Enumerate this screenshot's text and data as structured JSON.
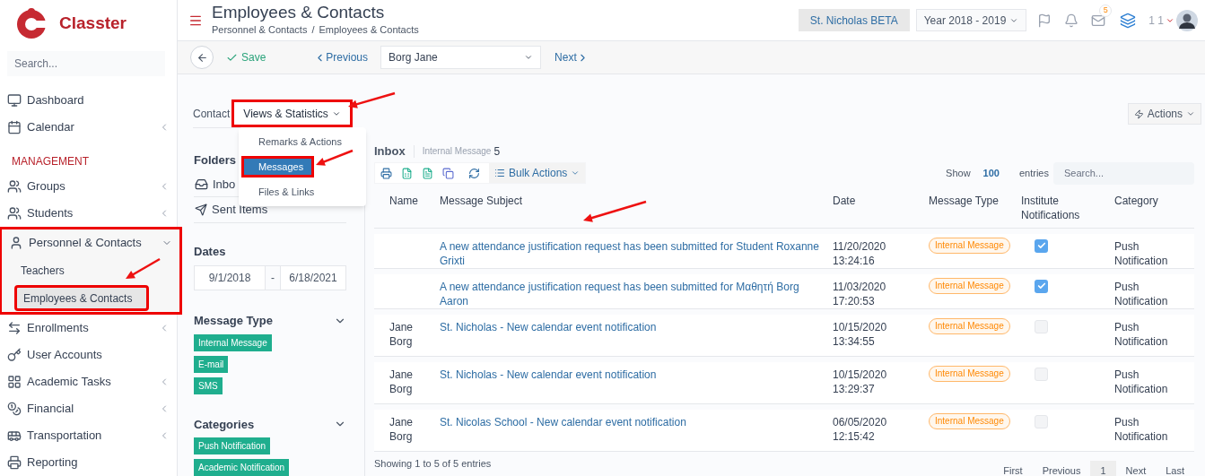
{
  "sidebar": {
    "logo_text": "Classter",
    "search_placeholder": "Search...",
    "items": [
      {
        "kind": "item",
        "label": "Dashboard",
        "highlighted": false
      },
      {
        "kind": "item",
        "label": "Calendar",
        "expanded": false,
        "highlighted": false
      },
      {
        "kind": "section",
        "label": "MANAGEMENT"
      },
      {
        "kind": "item",
        "label": "Groups",
        "expanded": false,
        "highlighted": false
      },
      {
        "kind": "item",
        "label": "Students",
        "expanded": false,
        "highlighted": false
      },
      {
        "kind": "item",
        "label": "Personnel & Contacts",
        "expanded": true,
        "highlighted": true,
        "children": [
          {
            "label": "Teachers",
            "selected": false,
            "highlighted": false
          },
          {
            "label": "Employees & Contacts",
            "selected": true,
            "highlighted": true
          }
        ]
      },
      {
        "kind": "item",
        "label": "Enrollments",
        "expanded": false,
        "highlighted": false
      },
      {
        "kind": "item",
        "label": "User Accounts",
        "highlighted": false
      },
      {
        "kind": "item",
        "label": "Academic Tasks",
        "expanded": false,
        "highlighted": false
      },
      {
        "kind": "item",
        "label": "Financial",
        "expanded": false,
        "highlighted": false
      },
      {
        "kind": "item",
        "label": "Transportation",
        "expanded": false,
        "highlighted": false
      },
      {
        "kind": "item",
        "label": "Reporting",
        "highlighted": false
      }
    ]
  },
  "header": {
    "title": "Employees & Contacts",
    "breadcrumb": [
      "Personnel & Contacts",
      "Employees & Contacts"
    ],
    "breadcrumb_separator": "/",
    "school": "St. Nicholas BETA",
    "year": "Year 2018 - 2019",
    "mail_badge": "5",
    "user": "1 1"
  },
  "toolbar": {
    "save": "Save",
    "previous": "Previous",
    "record": "Borg Jane",
    "next": "Next"
  },
  "tabs": [
    {
      "label": "Contact",
      "selected": false,
      "highlighted": false,
      "dropdown": false
    },
    {
      "label": "Views & Statistics",
      "selected": true,
      "highlighted": true,
      "dropdown": true
    }
  ],
  "tab_menu": [
    {
      "label": "Remarks & Actions",
      "selected": false,
      "highlighted": false
    },
    {
      "label": "Messages",
      "selected": true,
      "highlighted": true
    },
    {
      "label": "Files & Links",
      "selected": false,
      "highlighted": false
    }
  ],
  "actions": "Actions",
  "folders": {
    "title": "Folders",
    "items": [
      {
        "label": "Inbo",
        "kind": "inbox"
      },
      {
        "label": "Sent Items",
        "kind": "sent"
      }
    ]
  },
  "dates": {
    "title": "Dates",
    "from": "9/1/2018",
    "separator": "-",
    "to": "6/18/2021"
  },
  "filters": [
    {
      "title": "Message Type",
      "expanded": true,
      "tags": [
        "Internal Message",
        "E-mail",
        "SMS"
      ]
    },
    {
      "title": "Categories",
      "expanded": true,
      "tags": [
        "Push Notification",
        "Academic Notification"
      ]
    }
  ],
  "inbox": {
    "title": "Inbox",
    "subtitle": "Internal Message",
    "count": "5",
    "bulk_actions": "Bulk Actions",
    "show": "Show",
    "page_size": "100",
    "entries": "entries",
    "search_placeholder": "Search...",
    "columns": [
      "Name",
      "Message Subject",
      "Date",
      "Message Type",
      "Institute Notifications",
      "Category"
    ],
    "rows": [
      {
        "name": "",
        "subject": "A new attendance justification request has been submitted for Student Roxanne Grixti",
        "date": "11/20/2020 13:24:16",
        "type": "Internal Message",
        "institute": true,
        "category": "Push Notification"
      },
      {
        "name": "",
        "subject": "A new attendance justification request has been submitted for Μαθητή Borg Aaron",
        "date": "11/03/2020 17:20:53",
        "type": "Internal Message",
        "institute": true,
        "category": "Push Notification"
      },
      {
        "name": "Jane Borg",
        "subject": "St. Nicholas - New calendar event notification",
        "date": "10/15/2020 13:34:55",
        "type": "Internal Message",
        "institute": false,
        "category": "Push Notification"
      },
      {
        "name": "Jane Borg",
        "subject": "St. Nicholas - New calendar event notification",
        "date": "10/15/2020 13:29:37",
        "type": "Internal Message",
        "institute": false,
        "category": "Push Notification"
      },
      {
        "name": "Jane Borg",
        "subject": "St. Nicolas School - New calendar event notification",
        "date": "06/05/2020 12:15:42",
        "type": "Internal Message",
        "institute": false,
        "category": "Push Notification"
      }
    ],
    "summary": "Showing 1 to 5 of 5 entries",
    "pages": [
      {
        "label": "First",
        "selected": false
      },
      {
        "label": "Previous",
        "selected": false
      },
      {
        "label": "1",
        "selected": true
      },
      {
        "label": "Next",
        "selected": false
      },
      {
        "label": "Last",
        "selected": false
      }
    ]
  }
}
